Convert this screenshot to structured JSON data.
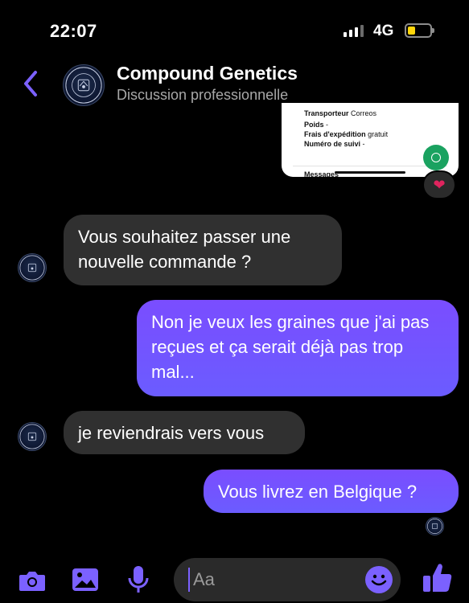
{
  "status_bar": {
    "time": "22:07",
    "network": "4G",
    "battery_level": 0.35,
    "battery_color": "#ffd60a"
  },
  "header": {
    "back_icon": "chevron-left-icon",
    "title": "Compound Genetics",
    "subtitle": "Discussion professionnelle",
    "avatar_text": "COMPOUND GENETICS",
    "accent_color": "#7b61ff"
  },
  "shared_image": {
    "rows": [
      {
        "label": "Transporteur",
        "value": "Correos"
      },
      {
        "label": "Poids",
        "value": "-"
      },
      {
        "label": "Frais d'expédition",
        "value": "gratuit"
      },
      {
        "label": "Numéro de suivi",
        "value": "-"
      }
    ],
    "footer_label": "Messages",
    "reaction": "❤"
  },
  "messages": [
    {
      "direction": "incoming",
      "text": "Vous souhaitez passer une nouvelle commande ?"
    },
    {
      "direction": "outgoing",
      "text": "Non je veux les graines que j'ai pas reçues et ça serait déjà pas trop mal..."
    },
    {
      "direction": "incoming",
      "text": "je reviendrais vers vous"
    },
    {
      "direction": "outgoing",
      "text": "Vous livrez en Belgique ?"
    }
  ],
  "composer": {
    "placeholder": "Aa",
    "icons": [
      "camera-icon",
      "image-icon",
      "microphone-icon",
      "emoji-icon",
      "thumbs-up-icon"
    ]
  }
}
